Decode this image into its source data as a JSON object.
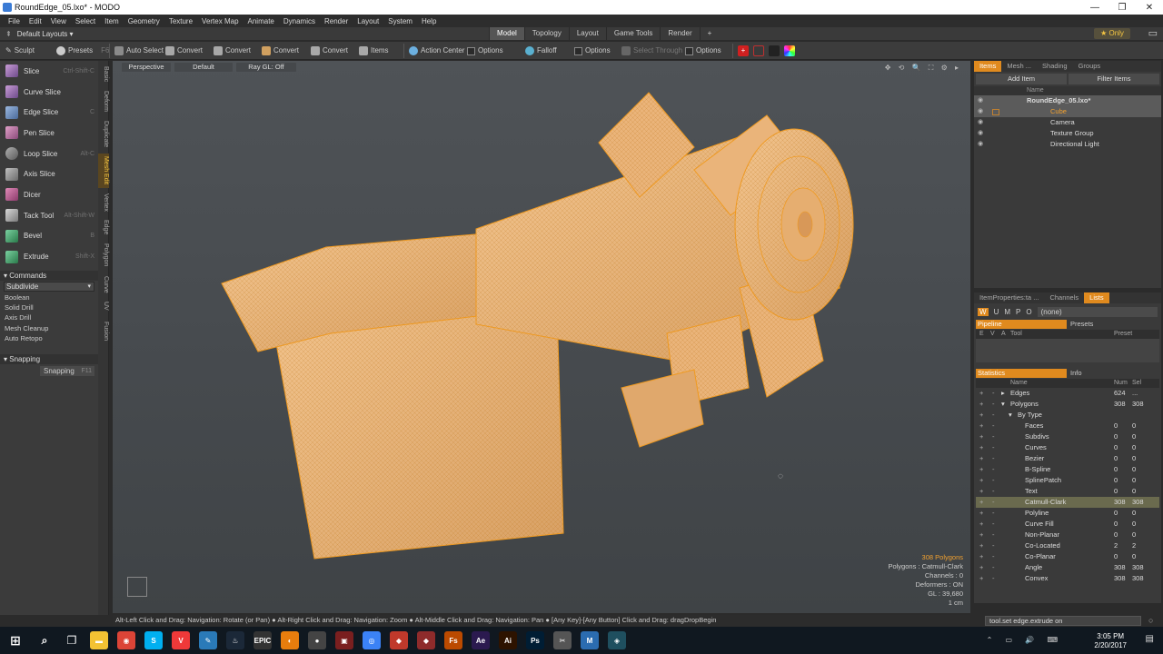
{
  "window": {
    "title": "RoundEdge_05.lxo* - MODO",
    "controls": [
      "—",
      "❐",
      "✕"
    ]
  },
  "menu": [
    "File",
    "Edit",
    "View",
    "Select",
    "Item",
    "Geometry",
    "Texture",
    "Vertex Map",
    "Animate",
    "Dynamics",
    "Render",
    "Layout",
    "System",
    "Help"
  ],
  "layout_selector": "Default Layouts ▾",
  "tabs": [
    "Model",
    "Topology",
    "Layout",
    "Game Tools",
    "Render"
  ],
  "active_tab": "Model",
  "only_label": "★ Only",
  "toolbar": {
    "sculpt": "Sculpt",
    "presets": "Presets",
    "presets_key": "F6",
    "auto_select": "Auto Select",
    "convert1": "Convert",
    "convert2": "Convert",
    "convert3": "Convert",
    "convert4": "Convert",
    "items": "Items",
    "action_center": "Action Center",
    "options1": "Options",
    "falloff": "Falloff",
    "options2": "Options",
    "select_through": "Select Through",
    "options3": "Options"
  },
  "tools": [
    {
      "label": "Slice",
      "shortcut": "Ctrl-Shift-C"
    },
    {
      "label": "Curve Slice",
      "shortcut": ""
    },
    {
      "label": "Edge Slice",
      "shortcut": "C"
    },
    {
      "label": "Pen Slice",
      "shortcut": ""
    },
    {
      "label": "Loop Slice",
      "shortcut": "Alt-C"
    },
    {
      "label": "Axis Slice",
      "shortcut": ""
    },
    {
      "label": "Dicer",
      "shortcut": ""
    },
    {
      "label": "Tack Tool",
      "shortcut": "Alt-Shift-W"
    },
    {
      "label": "Bevel",
      "shortcut": "B"
    },
    {
      "label": "Extrude",
      "shortcut": "Shift-X"
    }
  ],
  "commands": {
    "header": "Commands",
    "dropdown": "Subdivide",
    "items": [
      "Boolean",
      "Solid Drill",
      "Axis Drill",
      "Mesh Cleanup",
      "Auto Retopo"
    ]
  },
  "snapping": {
    "header": "Snapping",
    "button": "Snapping",
    "key": "F11"
  },
  "vertical_tabs": [
    "Basic",
    "Deform",
    "Duplicate",
    "Mesh Edit",
    "Vertex",
    "Edge",
    "Polygon",
    "Curve",
    "UV",
    "Fusion"
  ],
  "viewport": {
    "view": "Perspective",
    "shading": "Default",
    "raygl": "Ray GL: Off",
    "icons": "✥ ⟲ 🔍 ⛶ ⚙ ▸",
    "stats": {
      "polygons": "308 Polygons",
      "type": "Polygons : Catmull-Clark",
      "channels": "Channels : 0",
      "deformers": "Deformers : ON",
      "gl": "GL : 39,680",
      "unit": "1 cm"
    }
  },
  "hint": "Alt-Left Click and Drag: Navigation: Rotate (or Pan) ● Alt-Right Click and Drag: Navigation: Zoom ● Alt-Middle Click and Drag: Navigation: Pan ● [Any Key]-[Any Button] Click and Drag: dragDropBegin",
  "items_panel": {
    "tabs": [
      "Items",
      "Mesh ...",
      "Shading",
      "Groups"
    ],
    "add_item": "Add Item",
    "filter_items": "Filter Items",
    "column": "Name",
    "tree": [
      {
        "label": "RoundEdge_05.lxo*",
        "indent": 0
      },
      {
        "label": "Cube",
        "indent": 1
      },
      {
        "label": "Camera",
        "indent": 1
      },
      {
        "label": "Texture Group",
        "indent": 1
      },
      {
        "label": "Directional Light",
        "indent": 1
      }
    ]
  },
  "props_panel": {
    "tabs": [
      "ItemProperties:ta ...",
      "Channels",
      "Lists"
    ],
    "letters": [
      "W",
      "U",
      "M",
      "P",
      "O"
    ],
    "none_dd": "(none)",
    "pipeline": "Pipeline",
    "presets": "Presets",
    "cols": [
      "E",
      "V",
      "A",
      "Tool",
      "Preset"
    ],
    "statistics": "Statistics",
    "info": "Info",
    "stat_cols": [
      "Name",
      "Num",
      "Sel"
    ],
    "stats": [
      {
        "name": "Edges",
        "num": "624",
        "sel": "...",
        "indent": 0,
        "toggle": "▸"
      },
      {
        "name": "Polygons",
        "num": "308",
        "sel": "308",
        "indent": 0,
        "toggle": "▾"
      },
      {
        "name": "By Type",
        "num": "",
        "sel": "",
        "indent": 1,
        "toggle": "▾"
      },
      {
        "name": "Faces",
        "num": "0",
        "sel": "0",
        "indent": 2,
        "toggle": ""
      },
      {
        "name": "Subdivs",
        "num": "0",
        "sel": "0",
        "indent": 2,
        "toggle": ""
      },
      {
        "name": "Curves",
        "num": "0",
        "sel": "0",
        "indent": 2,
        "toggle": ""
      },
      {
        "name": "Bezier",
        "num": "0",
        "sel": "0",
        "indent": 2,
        "toggle": ""
      },
      {
        "name": "B-Spline",
        "num": "0",
        "sel": "0",
        "indent": 2,
        "toggle": ""
      },
      {
        "name": "SplinePatch",
        "num": "0",
        "sel": "0",
        "indent": 2,
        "toggle": ""
      },
      {
        "name": "Text",
        "num": "0",
        "sel": "0",
        "indent": 2,
        "toggle": ""
      },
      {
        "name": "Catmull-Clark",
        "num": "308",
        "sel": "308",
        "indent": 2,
        "toggle": "",
        "highlight": true
      },
      {
        "name": "Polyline",
        "num": "0",
        "sel": "0",
        "indent": 2,
        "toggle": ""
      },
      {
        "name": "Curve Fill",
        "num": "0",
        "sel": "0",
        "indent": 2,
        "toggle": ""
      },
      {
        "name": "Non-Planar",
        "num": "0",
        "sel": "0",
        "indent": 2,
        "toggle": ""
      },
      {
        "name": "Co-Located",
        "num": "2",
        "sel": "2",
        "indent": 2,
        "toggle": ""
      },
      {
        "name": "Co-Planar",
        "num": "0",
        "sel": "0",
        "indent": 2,
        "toggle": ""
      },
      {
        "name": "Angle",
        "num": "308",
        "sel": "308",
        "indent": 2,
        "toggle": ""
      },
      {
        "name": "Convex",
        "num": "308",
        "sel": "308",
        "indent": 2,
        "toggle": ""
      }
    ]
  },
  "command_line": "tool.set edge.extrude on",
  "clock": {
    "time": "3:05 PM",
    "date": "2/20/2017"
  },
  "taskbar_apps": [
    {
      "icon": "file-explorer-icon",
      "color": "#f3c233",
      "glyph": "▬"
    },
    {
      "icon": "chrome-icon",
      "color": "#db4437",
      "glyph": "◉"
    },
    {
      "icon": "skype-icon",
      "color": "#00aff0",
      "glyph": "S"
    },
    {
      "icon": "vivaldi-icon",
      "color": "#ef3939",
      "glyph": "V"
    },
    {
      "icon": "paint-icon",
      "color": "#2a7ab8",
      "glyph": "✎"
    },
    {
      "icon": "steam-icon",
      "color": "#1b2838",
      "glyph": "♨"
    },
    {
      "icon": "epic-icon",
      "color": "#333333",
      "glyph": "EPIC"
    },
    {
      "icon": "blender-icon",
      "color": "#e87d0d",
      "glyph": "◐"
    },
    {
      "icon": "obs-icon",
      "color": "#444444",
      "glyph": "●"
    },
    {
      "icon": "rec-icon",
      "color": "#7a1f1f",
      "glyph": "▣"
    },
    {
      "icon": "ring-icon",
      "color": "#3b82f6",
      "glyph": "◎"
    },
    {
      "icon": "app-icon-1",
      "color": "#c0392b",
      "glyph": "◆"
    },
    {
      "icon": "app-icon-2",
      "color": "#8e2b2b",
      "glyph": "◆"
    },
    {
      "icon": "fuse-icon",
      "color": "#bb4a00",
      "glyph": "Fs"
    },
    {
      "icon": "after-effects-icon",
      "color": "#2b1a4f",
      "glyph": "Ae"
    },
    {
      "icon": "illustrator-icon",
      "color": "#2d1300",
      "glyph": "Ai"
    },
    {
      "icon": "photoshop-icon",
      "color": "#001d34",
      "glyph": "Ps"
    },
    {
      "icon": "tools-icon",
      "color": "#555555",
      "glyph": "✂"
    },
    {
      "icon": "marvelous-icon",
      "color": "#2b6cb0",
      "glyph": "M"
    },
    {
      "icon": "modo-icon",
      "color": "#1f4f5f",
      "glyph": "◈"
    }
  ]
}
